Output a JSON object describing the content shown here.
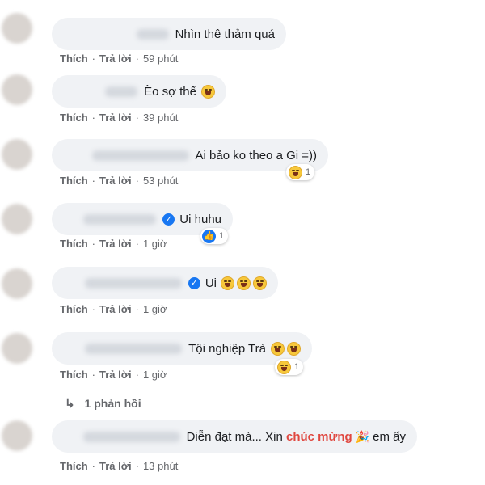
{
  "actions": {
    "like": "Thích",
    "reply": "Trả lời",
    "separator": "·"
  },
  "comments": [
    {
      "text": "Nhìn thê thảm quá",
      "time": "59 phút"
    },
    {
      "text": "Èo sợ thế",
      "time": "39 phút"
    },
    {
      "text": "Ai bảo ko theo a Gi =))",
      "time": "53 phút",
      "reaction_count": "1"
    },
    {
      "text": "Ui huhu",
      "time": "1 giờ",
      "reaction_count": "1"
    },
    {
      "text": "Ui",
      "time": "1 giờ"
    },
    {
      "text": "Tội nghiệp Trà",
      "time": "1 giờ",
      "reaction_count": "1"
    },
    {
      "text_before": "Diễn đạt mà... Xin",
      "text_highlight": "chúc mừng",
      "text_after": "em ấy",
      "time": "13 phút"
    }
  ],
  "replies_link": {
    "arrow": "↳",
    "label": "1 phản hồi"
  },
  "colors": {
    "bubble": "#f0f2f5",
    "like_blue": "#1877f2",
    "highlight": "#e0473f",
    "meta_gray": "#65676b"
  }
}
